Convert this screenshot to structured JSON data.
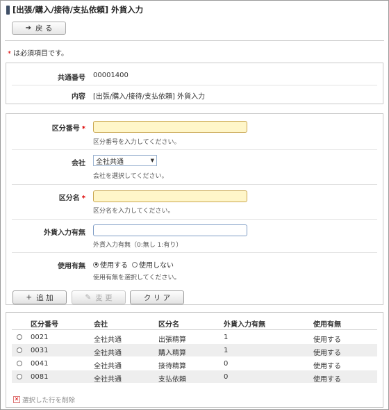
{
  "page": {
    "title": "[出張/購入/接待/支払依頼] 外貨入力",
    "back_label": "戻 る",
    "required_note": "は必須項目です。",
    "required_mark": "*"
  },
  "info": {
    "common_no_label": "共通番号",
    "common_no_value": "00001400",
    "content_label": "内容",
    "content_value": "[出張/購入/接待/支払依頼] 外貨入力"
  },
  "form": {
    "kubun_no_label": "区分番号",
    "kubun_no_value": "",
    "kubun_no_hint": "区分番号を入力してください。",
    "company_label": "会社",
    "company_value": "全社共通",
    "company_hint": "会社を選択してください。",
    "kubun_name_label": "区分名",
    "kubun_name_value": "",
    "kubun_name_hint": "区分名を入力してください。",
    "fx_label": "外貨入力有無",
    "fx_value": "",
    "fx_hint": "外貨入力有無（0:無し 1:有り）",
    "use_label": "使用有無",
    "use_on_label": "使用する",
    "use_off_label": "使用しない",
    "use_hint": "使用有無を選択してください。"
  },
  "actions": {
    "add_label": "追 加",
    "change_label": "変 更",
    "clear_label": "ク リ ア"
  },
  "table": {
    "headers": [
      "区分番号",
      "会社",
      "区分名",
      "外貨入力有無",
      "使用有無"
    ],
    "rows": [
      [
        "0021",
        "全社共通",
        "出張精算",
        "1",
        "使用する"
      ],
      [
        "0031",
        "全社共通",
        "購入精算",
        "1",
        "使用する"
      ],
      [
        "0041",
        "全社共通",
        "接待精算",
        "0",
        "使用する"
      ],
      [
        "0081",
        "全社共通",
        "支払依頼",
        "0",
        "使用する"
      ]
    ],
    "delete_label": "選択した行を削除"
  },
  "colors": {
    "required": "#dd0000",
    "required_input_bg": "#fff6c9",
    "title_bar": "#3f4f66",
    "row_alt": "#eeeeee"
  }
}
